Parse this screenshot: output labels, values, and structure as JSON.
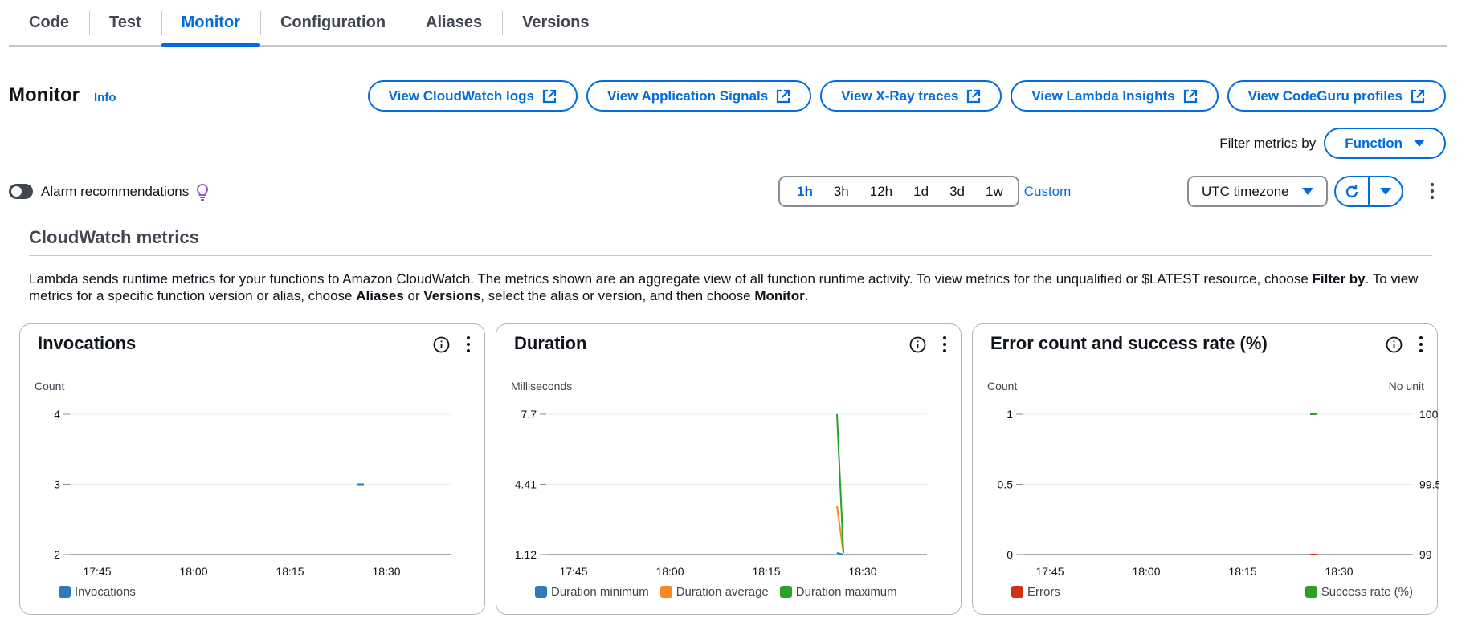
{
  "tabs": [
    {
      "label": "Code"
    },
    {
      "label": "Test"
    },
    {
      "label": "Monitor"
    },
    {
      "label": "Configuration"
    },
    {
      "label": "Aliases"
    },
    {
      "label": "Versions"
    }
  ],
  "header": {
    "title": "Monitor",
    "info": "Info",
    "buttons": [
      {
        "label": "View CloudWatch logs",
        "icon": "external-link-icon"
      },
      {
        "label": "View Application Signals",
        "icon": "external-link-icon"
      },
      {
        "label": "View X-Ray traces",
        "icon": "external-link-icon"
      },
      {
        "label": "View Lambda Insights",
        "icon": "external-link-icon"
      },
      {
        "label": "View CodeGuru profiles",
        "icon": "external-link-icon"
      }
    ],
    "filter_label": "Filter metrics by",
    "filter_value": "Function"
  },
  "controls": {
    "alarm_label": "Alarm recommendations",
    "alarm_enabled": false,
    "time_ranges": [
      "1h",
      "3h",
      "12h",
      "1d",
      "3d",
      "1w"
    ],
    "active_range": "1h",
    "custom_label": "Custom",
    "timezone": "UTC timezone"
  },
  "section": {
    "title": "CloudWatch metrics",
    "desc_1": "Lambda sends runtime metrics for your functions to Amazon CloudWatch. The metrics shown are an aggregate view of all function runtime activity. To view metrics for the unqualified or $LATEST resource, choose ",
    "desc_b1": "Filter by",
    "desc_2": ". To view metrics for a specific function version or alias, choose ",
    "desc_b2": "Aliases",
    "desc_3": " or ",
    "desc_b3": "Versions",
    "desc_4": ", select the alias or version, and then choose ",
    "desc_b4": "Monitor",
    "desc_5": "."
  },
  "colors": {
    "accent": "#006ce0",
    "blue": "#2a7bbf",
    "orange": "#f68a21",
    "green": "#2aa12a",
    "red": "#d13212"
  },
  "chart_data": [
    {
      "type": "line",
      "title": "Invocations",
      "ylabel": "Count",
      "y_ticks": [
        "4",
        "3",
        "2"
      ],
      "ylim": [
        2,
        4
      ],
      "x_ticks": [
        "17:45",
        "18:00",
        "18:15",
        "18:30"
      ],
      "series": [
        {
          "name": "Invocations",
          "color": "#2a7bbf",
          "points": [
            [
              "18:26",
              3
            ]
          ]
        }
      ]
    },
    {
      "type": "line",
      "title": "Duration",
      "ylabel": "Milliseconds",
      "y_ticks": [
        "7.7",
        "4.41",
        "1.12"
      ],
      "ylim": [
        1.12,
        7.7
      ],
      "x_ticks": [
        "17:45",
        "18:00",
        "18:15",
        "18:30"
      ],
      "series": [
        {
          "name": "Duration minimum",
          "color": "#2a7bbf",
          "points": [
            [
              "18:26",
              1.2
            ],
            [
              "18:27",
              1.12
            ]
          ]
        },
        {
          "name": "Duration average",
          "color": "#f68a21",
          "points": [
            [
              "18:26",
              3.4
            ],
            [
              "18:27",
              1.2
            ]
          ]
        },
        {
          "name": "Duration maximum",
          "color": "#2aa12a",
          "points": [
            [
              "18:26",
              7.7
            ],
            [
              "18:27",
              1.2
            ]
          ]
        }
      ]
    },
    {
      "type": "line",
      "title": "Error count and success rate (%)",
      "ylabel": "Count",
      "y2label": "No unit",
      "y_ticks": [
        "1",
        "0.5",
        "0"
      ],
      "y2_ticks": [
        "100",
        "99.5",
        "99"
      ],
      "ylim": [
        0,
        1
      ],
      "y2lim": [
        99,
        100
      ],
      "x_ticks": [
        "17:45",
        "18:00",
        "18:15",
        "18:30"
      ],
      "series": [
        {
          "name": "Errors",
          "color": "#d13212",
          "axis": "left",
          "points": [
            [
              "18:26",
              0
            ]
          ]
        },
        {
          "name": "Success rate (%)",
          "color": "#2aa12a",
          "axis": "right",
          "points": [
            [
              "18:26",
              100
            ]
          ]
        }
      ]
    }
  ]
}
